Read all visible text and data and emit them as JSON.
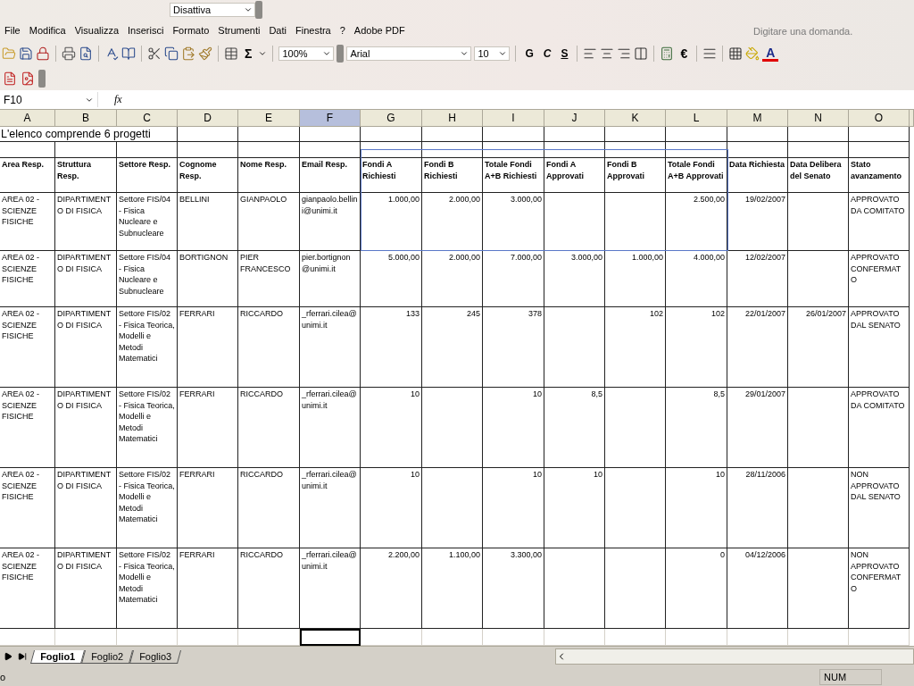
{
  "top_toolbar": {
    "dropdown": "Disattiva"
  },
  "menu_bar": [
    "File",
    "Modifica",
    "Visualizza",
    "Inserisci",
    "Formato",
    "Strumenti",
    "Dati",
    "Finestra",
    "?",
    "Adobe PDF"
  ],
  "help_search": {
    "placeholder": "Digitare una domanda."
  },
  "toolbar": {
    "sum_symbol": "Σ",
    "zoom": "100%",
    "font": "Arial",
    "font_size": "10",
    "bold": "G",
    "italic": "C",
    "underline": "S",
    "currency": "€",
    "font_color": "A"
  },
  "formula_bar": {
    "name_box": "F10",
    "fx": "fx"
  },
  "sheet": {
    "columns": [
      {
        "label": "A",
        "selected": false
      },
      {
        "label": "B",
        "selected": false
      },
      {
        "label": "C",
        "selected": false
      },
      {
        "label": "D",
        "selected": false
      },
      {
        "label": "E",
        "selected": false
      },
      {
        "label": "F",
        "selected": true
      },
      {
        "label": "G",
        "selected": false
      },
      {
        "label": "H",
        "selected": false
      },
      {
        "label": "I",
        "selected": false
      },
      {
        "label": "J",
        "selected": false
      },
      {
        "label": "K",
        "selected": false
      },
      {
        "label": "L",
        "selected": false
      },
      {
        "label": "M",
        "selected": false
      },
      {
        "label": "N",
        "selected": false
      },
      {
        "label": "O",
        "selected": false
      }
    ],
    "title": "L'elenco comprende 6 progetti",
    "headers": {
      "A": "Area Resp.",
      "B": "Struttura Resp.",
      "C": "Settore Resp.",
      "D": "Cognome Resp.",
      "E": "Nome Resp.",
      "F": "Email Resp.",
      "G": "Fondi A Richiesti",
      "H": "Fondi B Richiesti",
      "I": "Totale Fondi A+B Richiesti",
      "J": "Fondi A Approvati",
      "K": "Fondi B Approvati",
      "L": "Totale Fondi A+B Approvati",
      "M": "Data Richiesta",
      "N": "Data Delibera del Senato",
      "O": "Stato avanzamento"
    },
    "rows": [
      {
        "A": "AREA 02 - SCIENZE FISICHE",
        "B": "DIPARTIMENTO DI FISICA",
        "C": "Settore FIS/04 - Fisica Nucleare e Subnucleare",
        "D": "BELLINI",
        "E": "GIANPAOLO",
        "F": "gianpaolo.bellini@unimi.it",
        "G": "1.000,00",
        "H": "2.000,00",
        "I": "3.000,00",
        "L": "2.500,00",
        "M": "19/02/2007",
        "O": "APPROVATO DA COMITATO"
      },
      {
        "A": "AREA 02 - SCIENZE FISICHE",
        "B": "DIPARTIMENTO DI FISICA",
        "C": "Settore FIS/04 - Fisica Nucleare e Subnucleare",
        "D": "BORTIGNON",
        "E": "PIER FRANCESCO",
        "F": "pier.bortignon@unimi.it",
        "G": "5.000,00",
        "H": "2.000,00",
        "I": "7.000,00",
        "J": "3.000,00",
        "K": "1.000,00",
        "L": "4.000,00",
        "M": "12/02/2007",
        "O": "APPROVATO CONFERMATO"
      },
      {
        "A": "AREA 02 - SCIENZE FISICHE",
        "B": "DIPARTIMENTO DI FISICA",
        "C": "Settore FIS/02 - Fisica Teorica, Modelli e Metodi Matematici",
        "D": "FERRARI",
        "E": "RICCARDO",
        "F": "_rferrari.cilea@unimi.it",
        "G": "133",
        "H": "245",
        "I": "378",
        "K": "102",
        "L": "102",
        "M": "22/01/2007",
        "N": "26/01/2007",
        "O": "APPROVATO DAL SENATO"
      },
      {
        "A": "AREA 02 - SCIENZE FISICHE",
        "B": "DIPARTIMENTO DI FISICA",
        "C": "Settore FIS/02 - Fisica Teorica, Modelli e Metodi Matematici",
        "D": "FERRARI",
        "E": "RICCARDO",
        "F": "_rferrari.cilea@unimi.it",
        "G": "10",
        "I": "10",
        "J": "8,5",
        "L": "8,5",
        "M": "29/01/2007",
        "O": "APPROVATO DA COMITATO"
      },
      {
        "A": "AREA 02 - SCIENZE FISICHE",
        "B": "DIPARTIMENTO DI FISICA",
        "C": "Settore FIS/02 - Fisica Teorica, Modelli e Metodi Matematici",
        "D": "FERRARI",
        "E": "RICCARDO",
        "F": "_rferrari.cilea@unimi.it",
        "G": "10",
        "I": "10",
        "J": "10",
        "L": "10",
        "M": "28/11/2006",
        "O": "NON APPROVATO DAL SENATO"
      },
      {
        "A": "AREA 02 - SCIENZE FISICHE",
        "B": "DIPARTIMENTO DI FISICA",
        "C": "Settore FIS/02 - Fisica Teorica, Modelli e Metodi Matematici",
        "D": "FERRARI",
        "E": "RICCARDO",
        "F": "_rferrari.cilea@unimi.it",
        "G": "2.200,00",
        "H": "1.100,00",
        "I": "3.300,00",
        "L": "0",
        "M": "04/12/2006",
        "O": "NON APPROVATO CONFERMATO"
      }
    ]
  },
  "sheet_tabs": [
    {
      "label": "Foglio1",
      "selected": true
    },
    {
      "label": "Foglio2",
      "selected": false
    },
    {
      "label": "Foglio3",
      "selected": false
    }
  ],
  "status_bar": {
    "left": "o",
    "num": "NUM"
  }
}
